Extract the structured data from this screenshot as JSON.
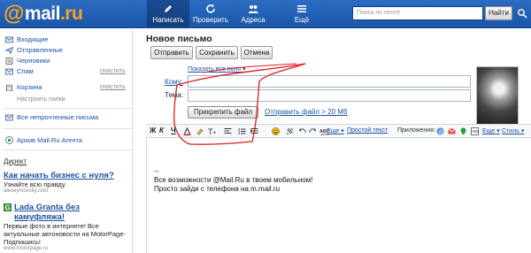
{
  "header": {
    "logo": {
      "at": "@",
      "name": "mail",
      "tld": ".ru"
    },
    "nav": [
      {
        "label": "Написать",
        "icon": "pencil-icon"
      },
      {
        "label": "Проверить",
        "icon": "refresh-icon"
      },
      {
        "label": "Адреса",
        "icon": "contacts-icon"
      },
      {
        "label": "Ещё",
        "icon": "more-icon"
      }
    ],
    "search_placeholder": "Поиск по почте",
    "search_button": "Найти",
    "accent_color": "#1a56a8"
  },
  "sidebar": {
    "folders": [
      {
        "label": "Входящие",
        "icon": "inbox-icon",
        "action": ""
      },
      {
        "label": "Отправленные",
        "icon": "sent-icon",
        "action": ""
      },
      {
        "label": "Черновики",
        "icon": "drafts-icon",
        "action": ""
      },
      {
        "label": "Спам",
        "icon": "spam-icon",
        "action": "очистить"
      },
      {
        "label": "Корзина",
        "icon": "trash-icon",
        "action": "очистить"
      }
    ],
    "folder_settings": "Настроить папки",
    "all_unread": "Все непрочтенные письма",
    "agent_archive": "Архив Mail.Ru Агента",
    "direct_label": "Директ",
    "ads": [
      {
        "title": "Как начать бизнес с нуля?",
        "text": "Узнайте всю правду.",
        "domain": "alexeymovsky.com"
      },
      {
        "title": "Lada Granta без камуфляжа!",
        "text": "Первые фото в интернете! Все актуальные автоновости на MotorPage-Подпишись!",
        "domain": "www.motorpage.ru"
      }
    ]
  },
  "compose": {
    "title": "Новое письмо",
    "buttons": {
      "send": "Отправить",
      "save": "Сохранить",
      "cancel": "Отмена"
    },
    "show_all_fields": "Показать все поля",
    "to_label": "Кому:",
    "to_value": "",
    "subject_label": "Тема:",
    "subject_value": "",
    "attach_button": "Прикрепить файл",
    "attach_large_link": "Отправить файл > 20 Мб"
  },
  "toolbar": {
    "bold": "Ж",
    "italic": "К",
    "underline": "Ч",
    "more_left": "Еще",
    "plain_text": "Простой текст",
    "apps_label": "Приложения:",
    "more_right": "Еще",
    "style": "Стиль"
  },
  "editor": {
    "lines": [
      "--",
      "Все возможности @Mail.Ru в твоем мобильном!",
      "Просто зайди с телефона на m.mail.ru"
    ]
  }
}
